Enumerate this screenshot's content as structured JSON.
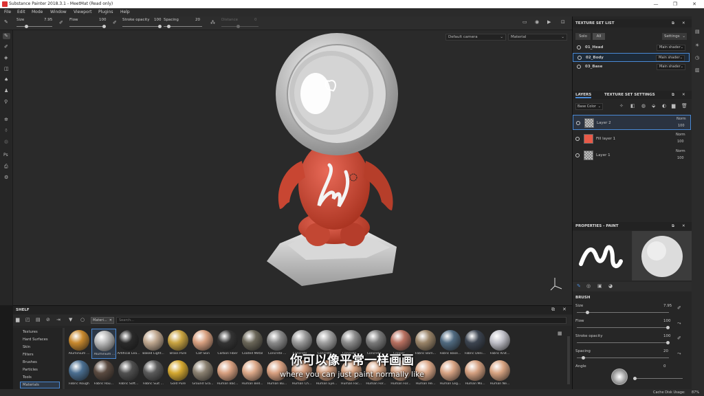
{
  "window": {
    "title": "Substance Painter 2018.3.1 - MeetMat (Read only)",
    "minimize": "—",
    "maximize": "❐",
    "close": "✕"
  },
  "menu": [
    "File",
    "Edit",
    "Mode",
    "Window",
    "Viewport",
    "Plugins",
    "Help"
  ],
  "toolbar": {
    "size_label": "Size",
    "size_value": "7.95",
    "flow_label": "Flow",
    "flow_value": "100",
    "stroke_label": "Stroke opacity",
    "stroke_value": "100",
    "spacing_label": "Spacing",
    "spacing_value": "20",
    "distance_label": "Distance",
    "distance_value": "0"
  },
  "viewport": {
    "camera": "Default camera",
    "mode": "Material"
  },
  "texture_set_list": {
    "title": "TEXTURE SET LIST",
    "solo": "Solo",
    "all": "All",
    "settings": "Settings",
    "items": [
      {
        "name": "01_Head",
        "shader": "Main shader"
      },
      {
        "name": "02_Body",
        "shader": "Main shader"
      },
      {
        "name": "03_Base",
        "shader": "Main shader"
      }
    ]
  },
  "layers": {
    "tab_layers": "LAYERS",
    "tab_tss": "TEXTURE SET SETTINGS",
    "channel": "Base Color",
    "items": [
      {
        "name": "Layer 2",
        "blend": "Norm",
        "opacity": "100"
      },
      {
        "name": "Fill layer 1",
        "blend": "Norm",
        "opacity": "100"
      },
      {
        "name": "Layer 1",
        "blend": "Norm",
        "opacity": "100"
      }
    ]
  },
  "properties": {
    "title": "PROPERTIES - PAINT",
    "brush_section": "BRUSH",
    "params": [
      {
        "label": "Size",
        "value": "7.95",
        "level": 0.1
      },
      {
        "label": "Flow",
        "value": "100",
        "level": 1
      },
      {
        "label": "Stroke opacity",
        "value": "100",
        "level": 1
      },
      {
        "label": "Spacing",
        "value": "20",
        "level": 0.05
      },
      {
        "label": "Angle",
        "value": "0",
        "level": 0
      }
    ]
  },
  "shelf": {
    "title": "SHELF",
    "filter_tag": "Materi...",
    "search_placeholder": "Search...",
    "categories": [
      "Textures",
      "Hard Surfaces",
      "Skin",
      "Filters",
      "Brushes",
      "Particles",
      "Tools",
      "Materials"
    ],
    "row1": [
      {
        "label": "Aluminium ...",
        "color": "#c8892e"
      },
      {
        "label": "Aluminium ...",
        "color": "#b8b8b8"
      },
      {
        "label": "Artificial Lea...",
        "color": "#2a2a2a"
      },
      {
        "label": "Baked Light...",
        "color": "#c0a890"
      },
      {
        "label": "Brass Pure",
        "color": "#c9a441"
      },
      {
        "label": "Calf Skin",
        "color": "#d8a080"
      },
      {
        "label": "Carbon Fiber",
        "color": "#333333"
      },
      {
        "label": "Coated Metal",
        "color": "#6a6658"
      },
      {
        "label": "Concrete ...",
        "color": "#8a8a8a"
      },
      {
        "label": "Concrete ...",
        "color": "#9a9a9a"
      },
      {
        "label": "Concrete ...",
        "color": "#a0a0a0"
      },
      {
        "label": "Concrete ...",
        "color": "#8c8c8c"
      },
      {
        "label": "Concrete ...",
        "color": "#7a7a7a"
      },
      {
        "label": "Copper ...",
        "color": "#b87060"
      },
      {
        "label": "Fabric Barn...",
        "color": "#9a8468"
      },
      {
        "label": "Fabric Base...",
        "color": "#506a80"
      },
      {
        "label": "Fabric Deni...",
        "color": "#3c4450"
      },
      {
        "label": "Fabric Knit...",
        "color": "#c0c0c8"
      }
    ],
    "row2": [
      {
        "label": "Fabric Rough",
        "color": "#4a6e90"
      },
      {
        "label": "Fabric Rou...",
        "color": "#5a4a40"
      },
      {
        "label": "Fabric Soft...",
        "color": "#505050"
      },
      {
        "label": "Fabric Suit ...",
        "color": "#5a5a5a"
      },
      {
        "label": "Gold Pure",
        "color": "#d4a830"
      },
      {
        "label": "Ground Gra...",
        "color": "#8a8070"
      },
      {
        "label": "Human Bac...",
        "color": "#d8a080"
      },
      {
        "label": "Human Bell...",
        "color": "#dca888"
      },
      {
        "label": "Human Bu...",
        "color": "#d8a080"
      },
      {
        "label": "Human Ch...",
        "color": "#d49c7c"
      },
      {
        "label": "Human Eye...",
        "color": "#d4a080"
      },
      {
        "label": "Human Fac...",
        "color": "#d8a482"
      },
      {
        "label": "Human For...",
        "color": "#daa684"
      },
      {
        "label": "Human For...",
        "color": "#d6a282"
      },
      {
        "label": "Human He...",
        "color": "#dca888"
      },
      {
        "label": "Human Leg...",
        "color": "#d8a484"
      },
      {
        "label": "Human Mo...",
        "color": "#d4a080"
      },
      {
        "label": "Human Ne...",
        "color": "#d8a482"
      }
    ]
  },
  "subtitles": {
    "zh": "你可以像平常一样画画",
    "en": "where you can just paint normally like"
  },
  "status": {
    "cache_label": "Cache Disk Usage:",
    "cache_value": "87%"
  }
}
